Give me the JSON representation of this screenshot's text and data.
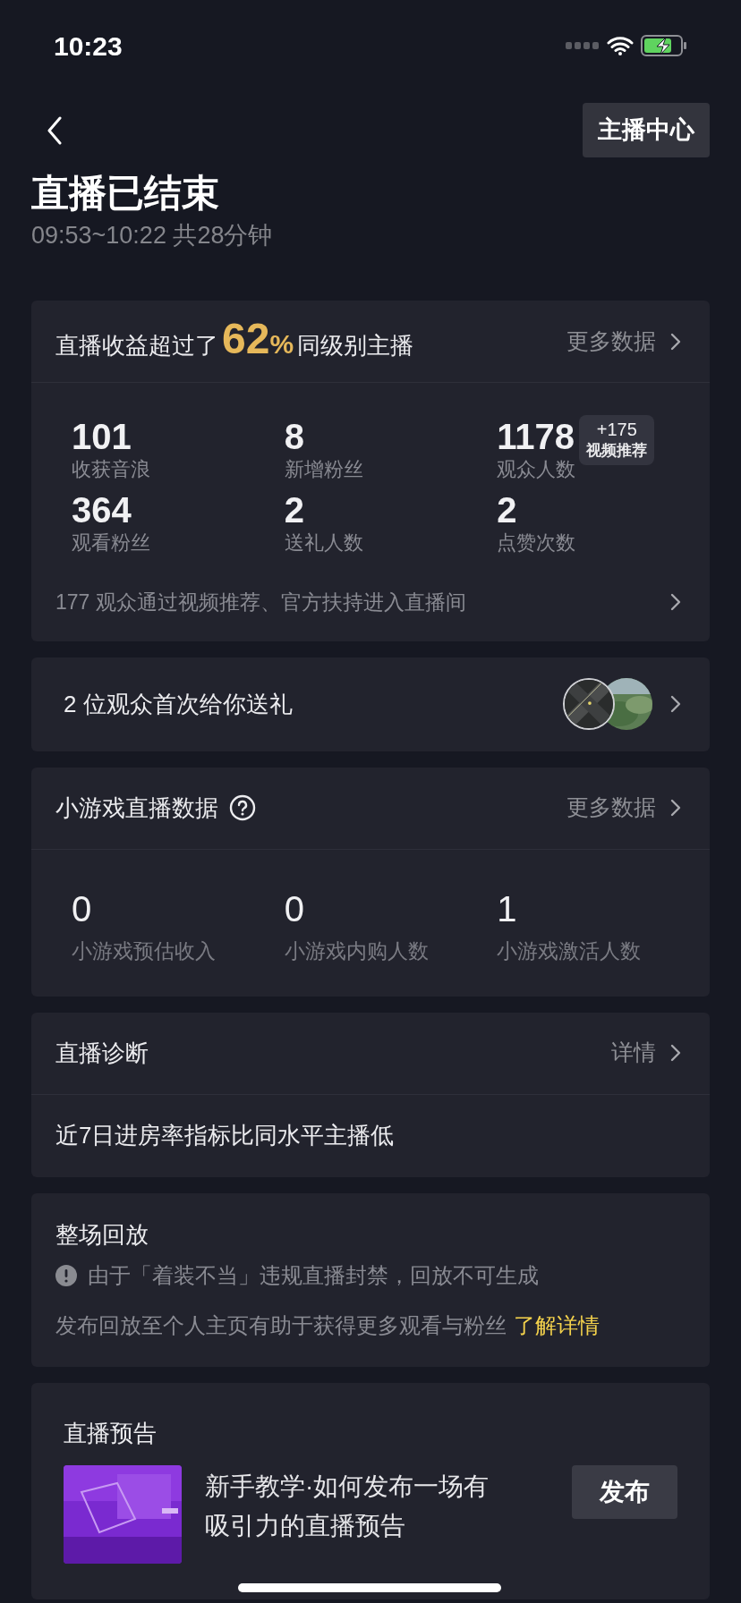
{
  "status_bar": {
    "time": "10:23"
  },
  "header": {
    "button": "主播中心",
    "title": "直播已结束",
    "subtitle": "09:53~10:22 共28分钟"
  },
  "revenue_card": {
    "prefix": "直播收益超过了",
    "percent": "62",
    "percent_sign": "%",
    "suffix": "同级别主播",
    "link": "更多数据",
    "stats": [
      {
        "value": "101",
        "label": "收获音浪"
      },
      {
        "value": "8",
        "label": "新增粉丝"
      },
      {
        "value": "1178",
        "label": "观众人数",
        "badge": {
          "value": "+175",
          "label": "视频推荐"
        }
      },
      {
        "value": "364",
        "label": "观看粉丝"
      },
      {
        "value": "2",
        "label": "送礼人数"
      },
      {
        "value": "2",
        "label": "点赞次数"
      }
    ],
    "footer": "177 观众通过视频推荐、官方扶持进入直播间"
  },
  "gift_card": {
    "text": "2 位观众首次给你送礼"
  },
  "game_card": {
    "title": "小游戏直播数据",
    "link": "更多数据",
    "stats": [
      {
        "value": "0",
        "label": "小游戏预估收入"
      },
      {
        "value": "0",
        "label": "小游戏内购人数"
      },
      {
        "value": "1",
        "label": "小游戏激活人数"
      }
    ]
  },
  "diagnosis_card": {
    "title": "直播诊断",
    "link": "详情",
    "message": "近7日进房率指标比同水平主播低"
  },
  "replay_card": {
    "title": "整场回放",
    "warning": "由于「着装不当」违规直播封禁，回放不可生成",
    "tip": "发布回放至个人主页有助于获得更多观看与粉丝",
    "link": "了解详情"
  },
  "preview_card": {
    "title": "直播预告",
    "item": {
      "title": "新手教学·如何发布一场有吸引力的直播预告",
      "button": "发布"
    }
  }
}
